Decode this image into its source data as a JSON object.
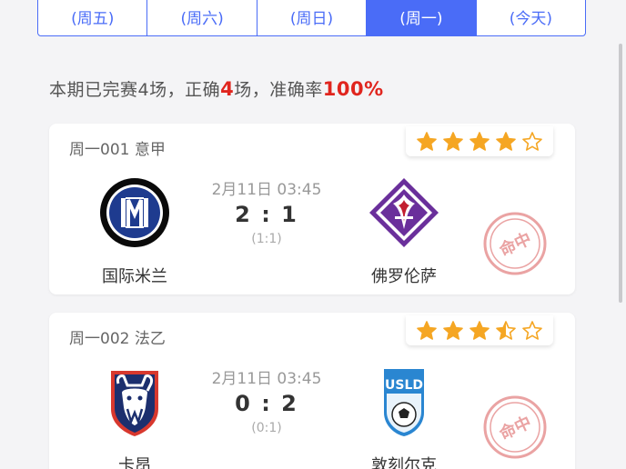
{
  "tabs": [
    {
      "label": "(周五)",
      "active": false
    },
    {
      "label": "(周六)",
      "active": false
    },
    {
      "label": "(周日)",
      "active": false
    },
    {
      "label": "(周一)",
      "active": true
    },
    {
      "label": "(今天)",
      "active": false
    }
  ],
  "summary": {
    "prefix": "本期已完赛4场，正确",
    "correct": "4",
    "middle": "场，准确率",
    "rate": "100%"
  },
  "matches": [
    {
      "league": "周一001 意甲",
      "stars": 4,
      "stars_total": 5,
      "home": {
        "name": "国际米兰",
        "logo": "inter-milan-logo"
      },
      "away": {
        "name": "佛罗伦萨",
        "logo": "fiorentina-logo"
      },
      "time": "2月11日 03:45",
      "score": "2 : 1",
      "half": "(1:1)",
      "stamp": "命中"
    },
    {
      "league": "周一002 法乙",
      "stars": 3.5,
      "stars_total": 5,
      "home": {
        "name": "卡昂",
        "logo": "caen-logo"
      },
      "away": {
        "name": "敦刻尔克",
        "logo": "dunkerque-logo"
      },
      "time": "2月11日 03:45",
      "score": "0 : 2",
      "half": "(0:1)",
      "stamp": "命中"
    }
  ],
  "colors": {
    "accent": "#4a6cf7",
    "highlight": "#e0251e",
    "star": "#f5a623",
    "stamp": "#e8a0a0"
  }
}
